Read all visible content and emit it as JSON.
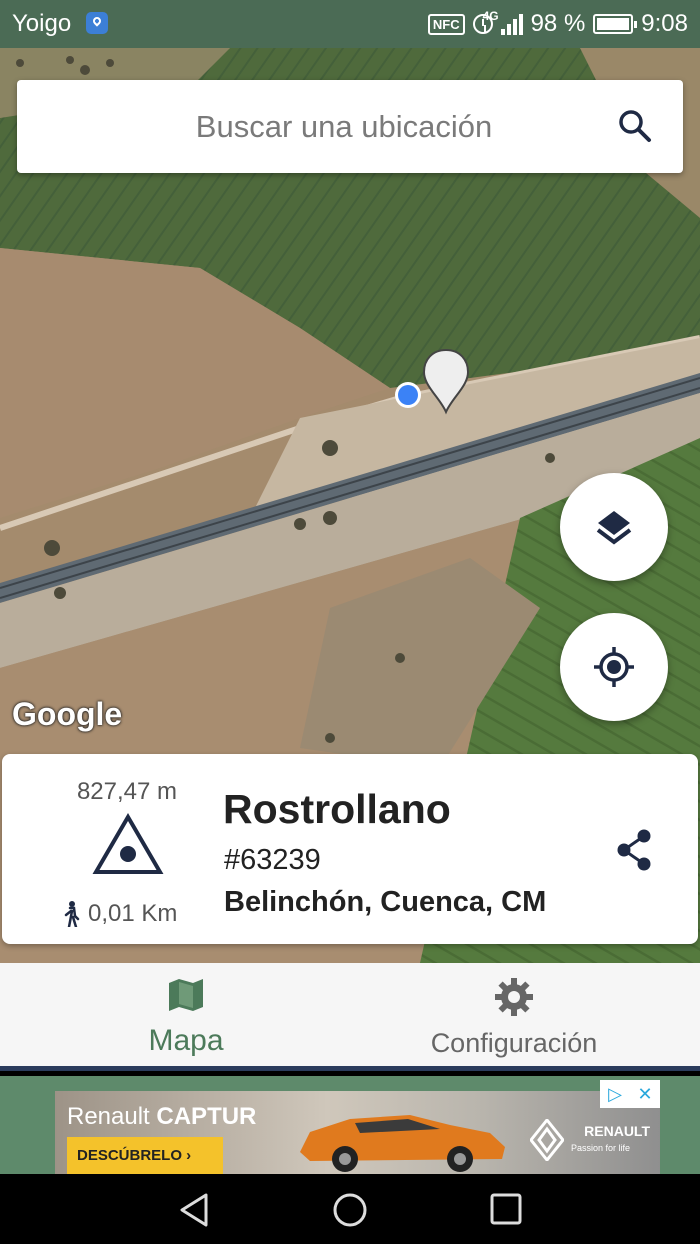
{
  "status_bar": {
    "carrier": "Yoigo",
    "nfc": "NFC",
    "network": "4G",
    "battery": "98 %",
    "time": "9:08"
  },
  "search": {
    "placeholder": "Buscar una ubicación"
  },
  "map": {
    "attribution": "Google",
    "icons": [
      "layers-icon",
      "my-location-icon",
      "search-icon"
    ]
  },
  "peak": {
    "elevation": "827,47 m",
    "distance": "0,01 Km",
    "name": "Rostrollano",
    "id": "#63239",
    "location": "Belinchón, Cuenca, CM"
  },
  "nav": {
    "map_label": "Mapa",
    "settings_label": "Configuración"
  },
  "ad": {
    "model_prefix": "Renault ",
    "model_name": "CAPTUR",
    "cta": "DESCÚBRELO ›",
    "brand": "RENAULT",
    "tagline": "Passion for life"
  },
  "colors": {
    "status_bar": "#4b6b55",
    "accent_green": "#4c7a5a",
    "nav_icon": "#2a3b5c",
    "location_dot": "#3b82f6"
  }
}
